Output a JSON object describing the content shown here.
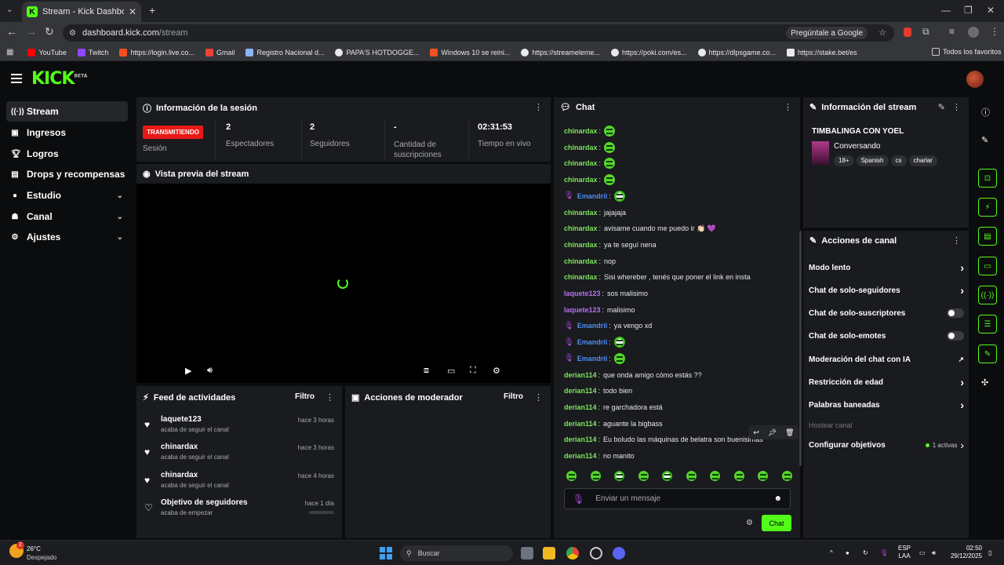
{
  "browser": {
    "tab_title": "Stream - Kick Dashboard",
    "url_domain": "dashboard.kick.com",
    "url_path": "/stream",
    "ask_google": "Pregúntale a Google",
    "bookmarks": [
      {
        "label": "YouTube",
        "color": "#ff0000"
      },
      {
        "label": "Twitch",
        "color": "#9146ff"
      },
      {
        "label": "https://login.live.co...",
        "color": "#f25022"
      },
      {
        "label": "Gmail",
        "color": "#ea4335"
      },
      {
        "label": "Registro Nacional d...",
        "color": "#8ab4f8"
      },
      {
        "label": "PAPA'S HOTDOGGE...",
        "color": "#e8eaed"
      },
      {
        "label": "Windows 10 se reini...",
        "color": "#f25022"
      },
      {
        "label": "https://streameleme...",
        "color": "#e8eaed"
      },
      {
        "label": "https://poki.com/es...",
        "color": "#e8eaed"
      },
      {
        "label": "https://dlpsgame.co...",
        "color": "#e8eaed"
      },
      {
        "label": "https://stake.bet/es",
        "color": "#e8eaed"
      }
    ],
    "all_favorites": "Todos los favoritos"
  },
  "header": {
    "logo": "KICK",
    "logo_badge": "BETA"
  },
  "sidebar": {
    "items": [
      {
        "label": "Stream",
        "icon": "signal-icon"
      },
      {
        "label": "Ingresos",
        "icon": "dollar-icon"
      },
      {
        "label": "Logros",
        "icon": "trophy-icon"
      },
      {
        "label": "Drops y recompensas",
        "icon": "gift-icon"
      },
      {
        "label": "Estudio",
        "icon": "studio-icon"
      },
      {
        "label": "Canal",
        "icon": "channel-icon"
      },
      {
        "label": "Ajustes",
        "icon": "gear-icon"
      }
    ]
  },
  "session": {
    "title": "Información de la sesión",
    "live_badge": "TRANSMITIENDO",
    "session_label": "Sesión",
    "stats": [
      {
        "value": "2",
        "label": "Espectadores"
      },
      {
        "value": "2",
        "label": "Seguidores"
      },
      {
        "value": "-",
        "label": "Cantidad de suscripciones"
      },
      {
        "value": "02:31:53",
        "label": "Tiempo en vivo"
      }
    ]
  },
  "preview": {
    "title": "Vista previa del stream"
  },
  "feed": {
    "title": "Feed de actividades",
    "filter": "Filtro",
    "items": [
      {
        "name": "laquete123",
        "sub": "acaba de seguir el canal",
        "time": "hace 3 horas"
      },
      {
        "name": "chinardax",
        "sub": "acaba de seguir el canal",
        "time": "hace 3 horas"
      },
      {
        "name": "chinardax",
        "sub": "acaba de seguir el canal",
        "time": "hace 4 horas"
      },
      {
        "name": "Objetivo de seguidores",
        "sub": "acaba de empezar",
        "time": "hace 1 día"
      }
    ],
    "goal_progress": 0
  },
  "mod_actions": {
    "title": "Acciones de moderador",
    "filter": "Filtro"
  },
  "chat": {
    "title": "Chat",
    "messages": [
      {
        "user": "chinardax",
        "text": "",
        "emote": true,
        "mic": false,
        "color": "#7ee35c"
      },
      {
        "user": "chinardax",
        "text": "",
        "emote": true,
        "mic": false,
        "color": "#7ee35c"
      },
      {
        "user": "chinardax",
        "text": "",
        "emote": true,
        "mic": false,
        "color": "#7ee35c"
      },
      {
        "user": "chinardax",
        "text": "",
        "emote": true,
        "mic": false,
        "color": "#7ee35c"
      },
      {
        "user": "Emandrii",
        "text": "",
        "emote": true,
        "mic": true,
        "color": "#4f8df5"
      },
      {
        "user": "chinardax",
        "text": "jajajaja",
        "emote": false,
        "mic": false,
        "color": "#7ee35c"
      },
      {
        "user": "chinardax",
        "text": "avisame cuando me puedo ir 👏🏻 💜",
        "emote": false,
        "mic": false,
        "color": "#7ee35c"
      },
      {
        "user": "chinardax",
        "text": "ya te seguí nena",
        "emote": false,
        "mic": false,
        "color": "#7ee35c"
      },
      {
        "user": "chinardax",
        "text": "nop",
        "emote": false,
        "mic": false,
        "color": "#7ee35c"
      },
      {
        "user": "chinardax",
        "text": "Sisi whereber , tenés que poner el link en insta",
        "emote": false,
        "mic": false,
        "color": "#7ee35c"
      },
      {
        "user": "laquete123",
        "text": "sos malisimo",
        "emote": false,
        "mic": false,
        "color": "#b771f0"
      },
      {
        "user": "laquete123",
        "text": "malisimo",
        "emote": false,
        "mic": false,
        "color": "#b771f0"
      },
      {
        "user": "Emandrii",
        "text": "ya vengo xd",
        "emote": false,
        "mic": true,
        "color": "#4f8df5"
      },
      {
        "user": "Emandrii",
        "text": "",
        "emote": true,
        "mic": true,
        "color": "#4f8df5"
      },
      {
        "user": "Emandrii",
        "text": "",
        "emote": true,
        "mic": true,
        "color": "#4f8df5"
      },
      {
        "user": "derian114",
        "text": "que onda amigo cómo estás ??",
        "emote": false,
        "mic": false,
        "color": "#7ee35c"
      },
      {
        "user": "derian114",
        "text": "todo bien",
        "emote": false,
        "mic": false,
        "color": "#7ee35c"
      },
      {
        "user": "derian114",
        "text": "re garchadora está",
        "emote": false,
        "mic": false,
        "color": "#7ee35c"
      },
      {
        "user": "derian114",
        "text": "aguante la bigbass",
        "emote": false,
        "mic": false,
        "color": "#7ee35c"
      },
      {
        "user": "derian114",
        "text": "Eu boludo las máquinas de belatra son buenisimas",
        "emote": false,
        "mic": false,
        "color": "#7ee35c"
      },
      {
        "user": "derian114",
        "text": "no manito",
        "emote": false,
        "mic": false,
        "color": "#7ee35c"
      }
    ],
    "input_placeholder": "Enviar un mensaje",
    "send_label": "Chat"
  },
  "stream_info": {
    "title": "Información del stream",
    "stream_title": "TIMBALINGA CON YOEL",
    "category": "Conversando",
    "tags": [
      "18+",
      "Spanish",
      "cs",
      "charlar"
    ]
  },
  "channel_actions": {
    "title": "Acciones de canal",
    "items": [
      {
        "label": "Modo lento",
        "control": "chevron"
      },
      {
        "label": "Chat de solo-seguidores",
        "control": "chevron"
      },
      {
        "label": "Chat de solo-suscriptores",
        "control": "toggle"
      },
      {
        "label": "Chat de solo-emotes",
        "control": "toggle"
      },
      {
        "label": "Moderación del chat con IA",
        "control": "external"
      },
      {
        "label": "Restricción de edad",
        "control": "chevron"
      },
      {
        "label": "Palabras baneadas",
        "control": "chevron"
      },
      {
        "label": "Hostear canal",
        "control": "none"
      },
      {
        "label": "Configurar objetivos",
        "control": "chevron"
      }
    ],
    "active_goals": "1 activas"
  },
  "taskbar": {
    "weather_temp": "26°C",
    "weather_desc": "Despejado",
    "search_placeholder": "Buscar",
    "lang_top": "ESP",
    "lang_bottom": "LAA",
    "time": "02:50",
    "date": "29/12/2025",
    "notif_badge": "2"
  },
  "colors": {
    "accent": "#53fc18",
    "live": "#e91916",
    "panel": "#191b1f",
    "background": "#0b0c0e"
  }
}
